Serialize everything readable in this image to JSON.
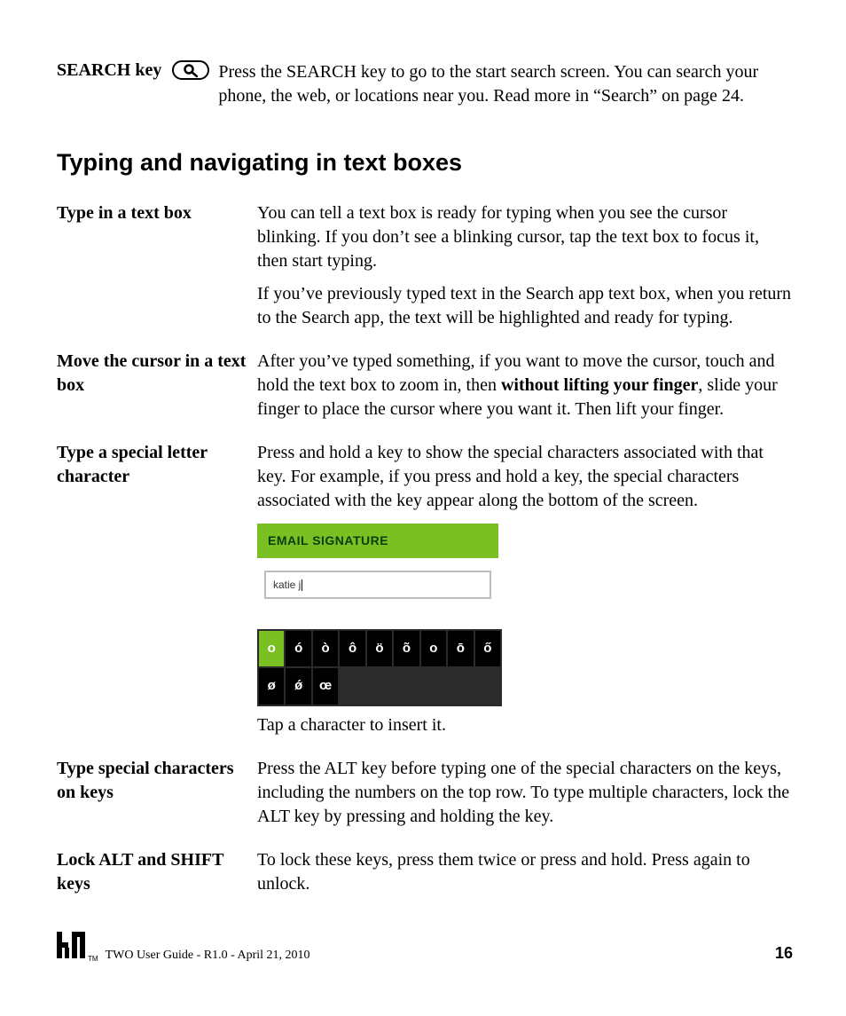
{
  "search_key": {
    "label": "SEARCH key",
    "icon_name": "search-icon",
    "description": "Press the SEARCH key to go to the start search screen. You can search your phone, the web, or locations near you. Read more in “Search” on page 24."
  },
  "section_heading": "Typing and navigating in text boxes",
  "rows": {
    "type_in_box": {
      "label": "Type in a text box",
      "p1": "You can tell a text box is ready for typing when you see the cursor blinking. If you don’t see a blinking cursor, tap the text box to focus it, then start typing.",
      "p2": "If you’ve previously typed text in the Search app text box, when you return to the Search app, the text will be highlighted and ready for typing."
    },
    "move_cursor": {
      "label": "Move the cursor in a text box",
      "p1_pre": "After you’ve typed something, if you want to move the cursor, touch and hold the text box to zoom in, then ",
      "p1_bold": "without lifting your finger",
      "p1_post": ", slide your finger to place the cursor where you want it. Then lift your finger."
    },
    "special_letter": {
      "label": "Type a special letter character",
      "p1": "Press and hold a key to show the special characters associated with that key. For example, if you press and hold a key, the special characters associated with the key appear along the bottom of the screen.",
      "figure": {
        "header": "EMAIL SIGNATURE",
        "input_value": "katie j"
      },
      "char_grid": {
        "row1": [
          "o",
          "ó",
          "ò",
          "ô",
          "ö",
          "õ",
          "o",
          "ō",
          "ő"
        ],
        "row2": [
          "ø",
          "ǿ",
          "œ"
        ]
      },
      "caption": "Tap a character to insert it."
    },
    "special_keys": {
      "label": "Type special characters on keys",
      "p1": "Press the ALT key before typing one of the special characters on the keys, including the numbers on the top row. To type multiple characters, lock the ALT key by pressing and holding the key."
    },
    "lock_keys": {
      "label": "Lock ALT and SHIFT keys",
      "p1": "To lock these keys, press them twice or press and hold. Press again to unlock."
    }
  },
  "footer": {
    "logo_name": "kin-logo",
    "tm": "TM",
    "text": "TWO User Guide - R1.0 - April 21, 2010",
    "page": "16"
  }
}
